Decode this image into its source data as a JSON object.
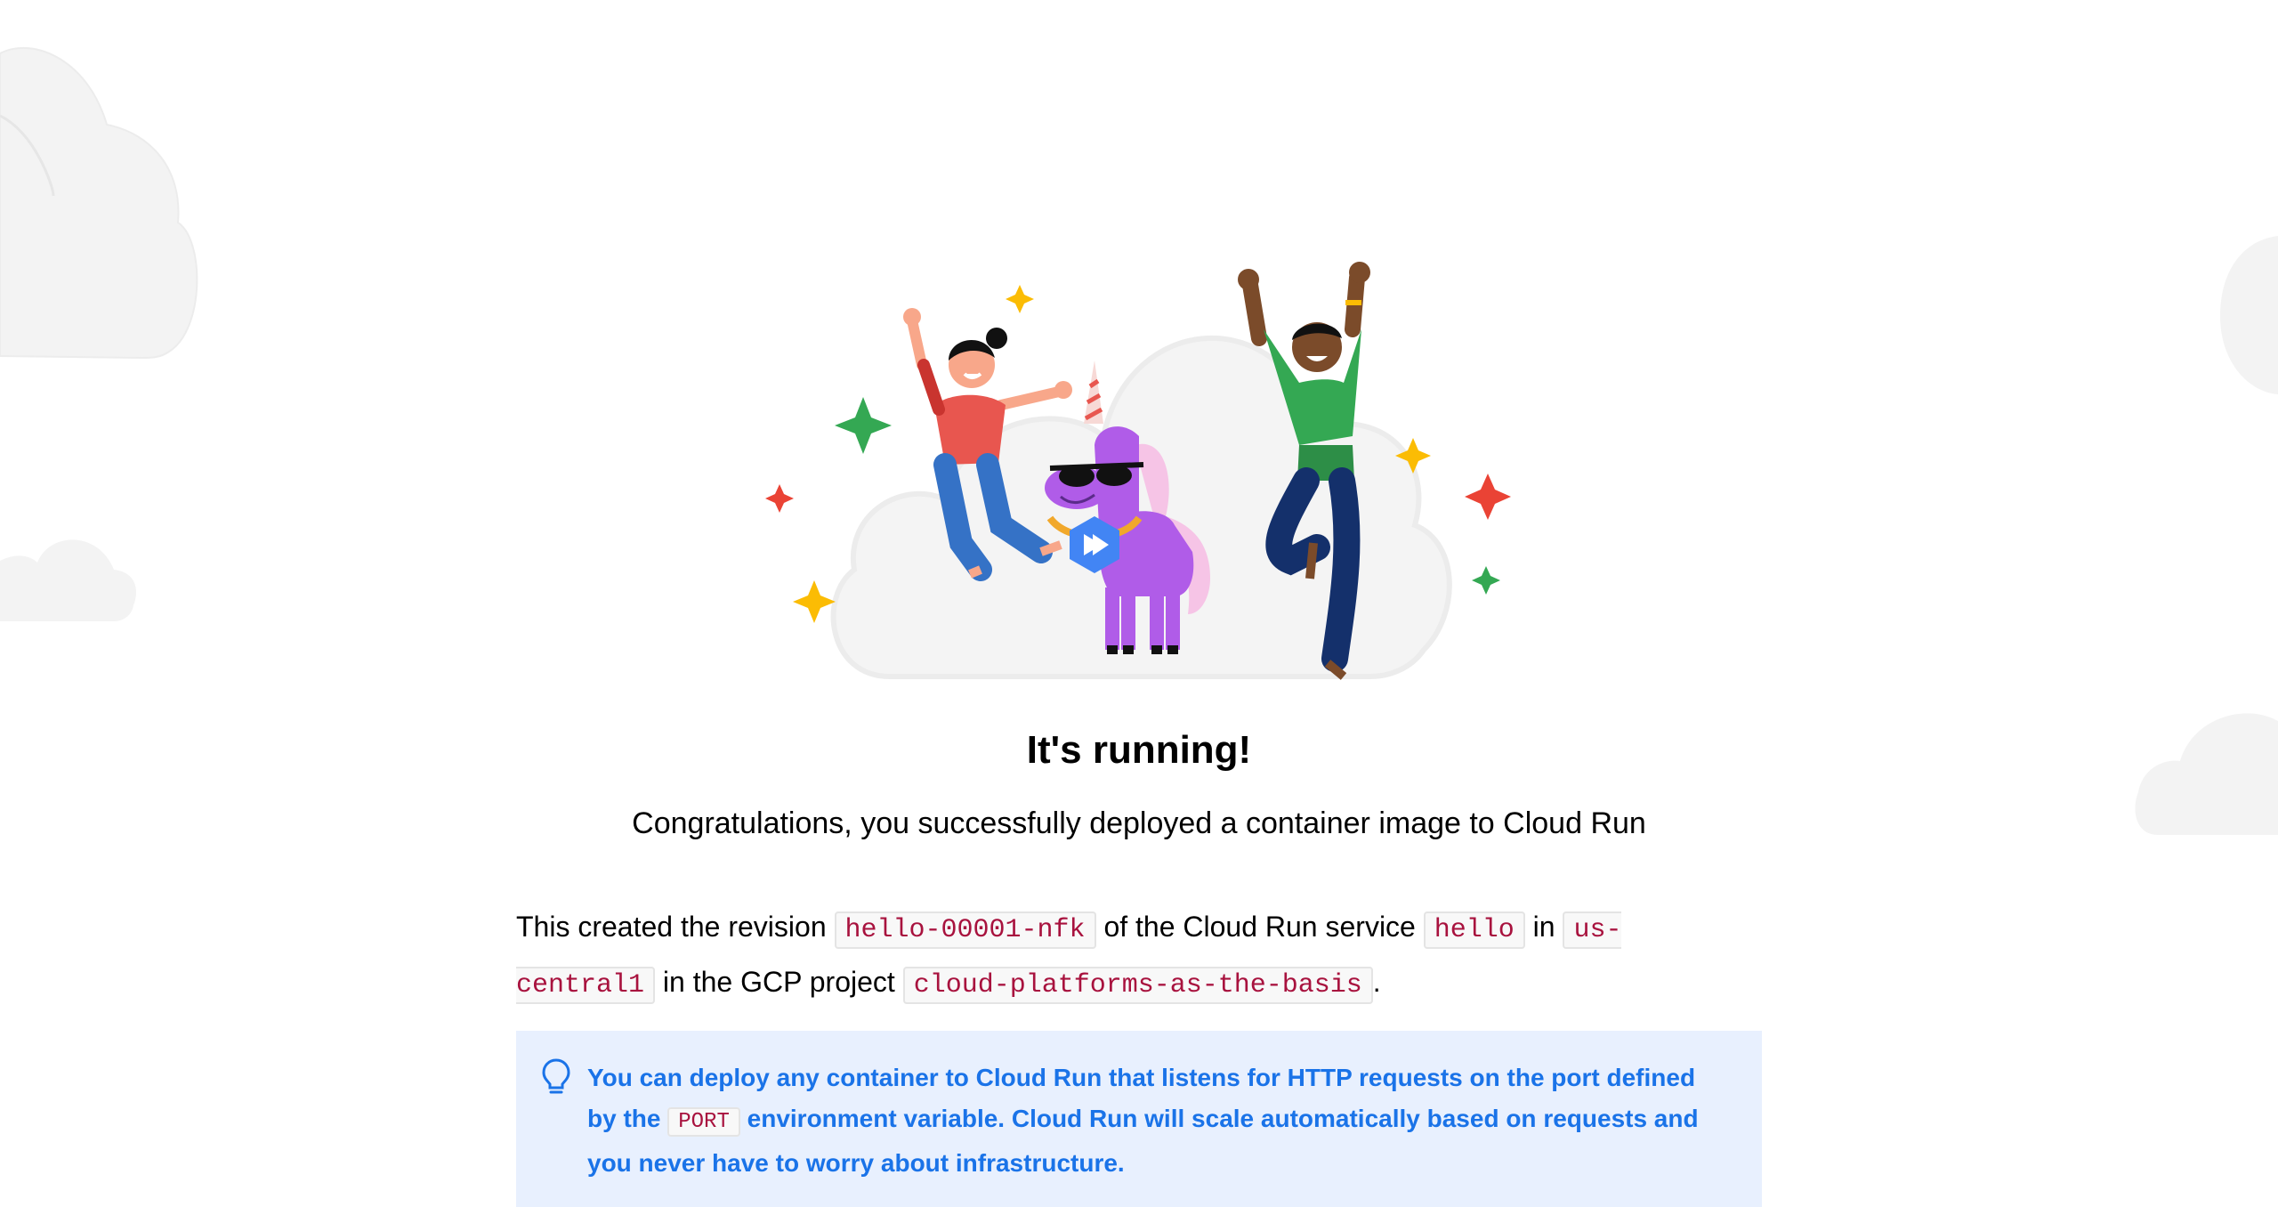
{
  "main": {
    "title": "It's running!",
    "subtitle": "Congratulations, you successfully deployed a container image to Cloud Run",
    "details": {
      "prefix": "This created the revision",
      "revision": "hello-00001-nfk",
      "service_text": "of the Cloud Run service",
      "service": "hello",
      "in_text": "in",
      "region": "us-central1",
      "project_text": "in the GCP project",
      "project": "cloud-platforms-as-the-basis",
      "suffix": "."
    },
    "tip": {
      "icon": "lightbulb-icon",
      "text_before": "You can deploy any container to Cloud Run that listens for HTTP requests on the port defined by the",
      "code": "PORT",
      "text_after": "environment variable. Cloud Run will scale automatically based on requests and you never have to worry about infrastructure."
    }
  },
  "illustration": {
    "name": "celebration-illustration",
    "characters": [
      "woman-jumping",
      "unicorn-with-sunglasses",
      "man-jumping"
    ],
    "badge_icon": "cloud-run-icon"
  },
  "colors": {
    "code_text": "#a8123e",
    "tip_background": "#e8f0fe",
    "tip_text": "#1a73e8",
    "cloud_bg": "#f1f1f1"
  }
}
